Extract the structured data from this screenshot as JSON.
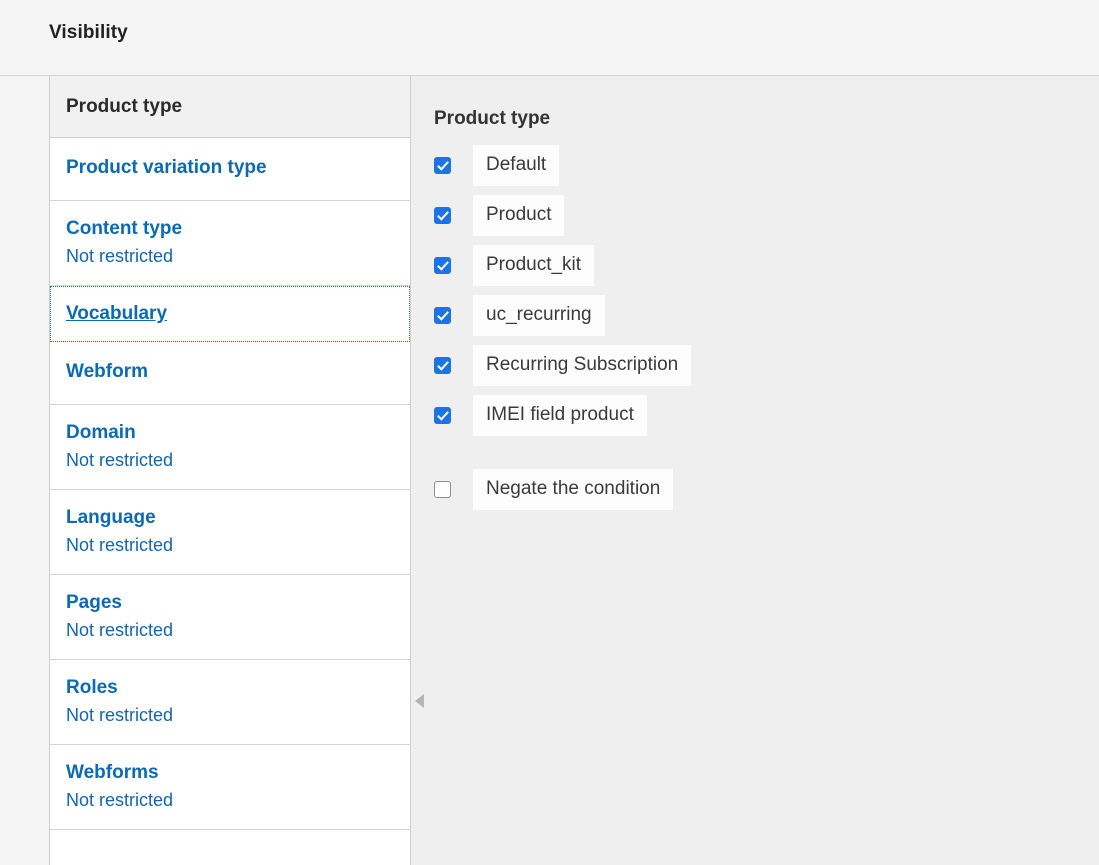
{
  "page": {
    "title": "Visibility"
  },
  "sidebar": {
    "header_title": "Product type",
    "items": [
      {
        "label": "Product variation type",
        "summary": "",
        "selected": false
      },
      {
        "label": "Content type",
        "summary": "Not restricted",
        "selected": false
      },
      {
        "label": "Vocabulary",
        "summary": "",
        "selected": true
      },
      {
        "label": "Webform",
        "summary": "",
        "selected": false
      },
      {
        "label": "Domain",
        "summary": "Not restricted",
        "selected": false
      },
      {
        "label": "Language",
        "summary": "Not restricted",
        "selected": false
      },
      {
        "label": "Pages",
        "summary": "Not restricted",
        "selected": false
      },
      {
        "label": "Roles",
        "summary": "Not restricted",
        "selected": false
      },
      {
        "label": "Webforms",
        "summary": "Not restricted",
        "selected": false
      }
    ]
  },
  "main": {
    "heading": "Product type",
    "options": [
      {
        "label": "Default",
        "checked": true
      },
      {
        "label": "Product",
        "checked": true
      },
      {
        "label": "Product_kit",
        "checked": true
      },
      {
        "label": "uc_recurring",
        "checked": true
      },
      {
        "label": "Recurring Subscription",
        "checked": true
      },
      {
        "label": "IMEI field product",
        "checked": true
      }
    ],
    "negate": {
      "label": "Negate the condition",
      "checked": false
    }
  },
  "colors": {
    "link": "#0b6ab8",
    "checkbox_accent": "#1a73e8",
    "page_background": "#f5f5f5",
    "pane_background": "#efefef",
    "panel_background": "#ffffff",
    "header_background": "#f1f1f1",
    "border": "#cfcfcf"
  },
  "icons": {
    "collapse_handle": "triangle-left-icon"
  }
}
